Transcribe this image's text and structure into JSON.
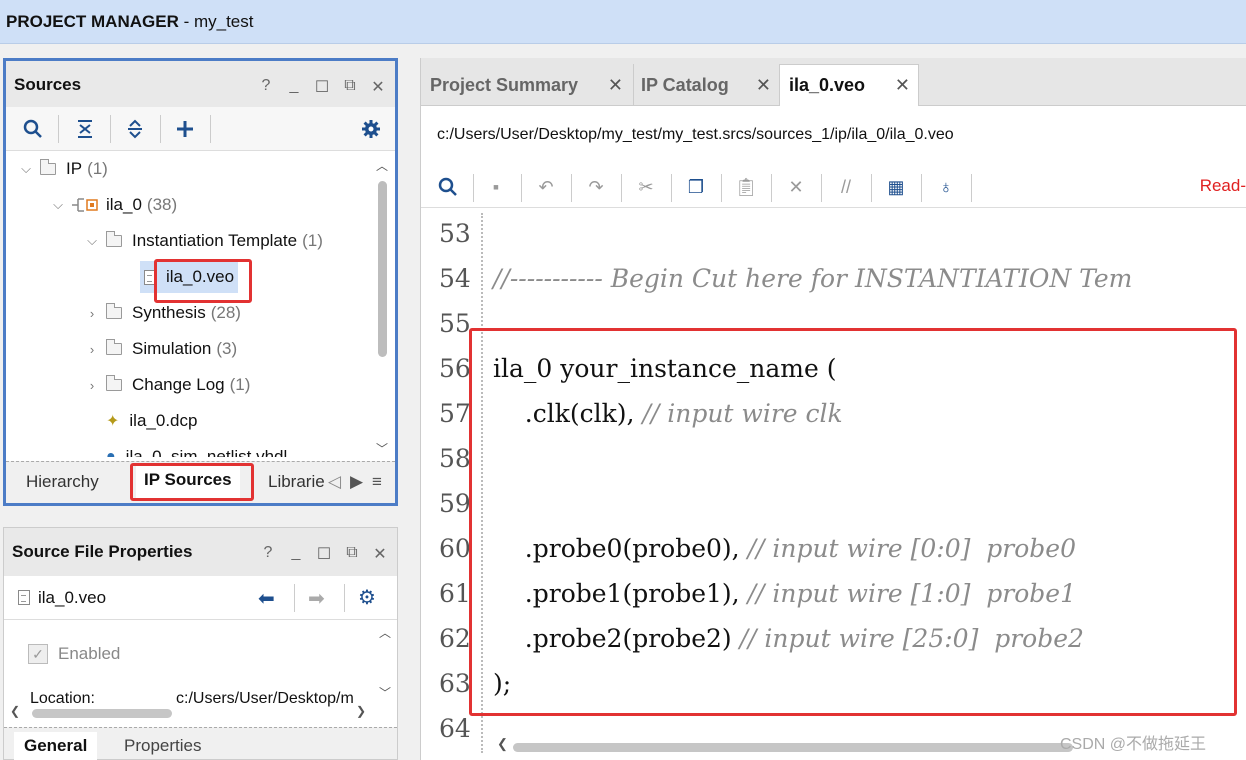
{
  "topbar": {
    "title_bold": "PROJECT MANAGER",
    "title_rest": " - my_test"
  },
  "sources": {
    "title": "Sources",
    "controls": [
      "?",
      "_",
      "☐",
      "⧉",
      "✕"
    ],
    "tree": [
      {
        "label": "IP",
        "count": "(1)"
      },
      {
        "label": "ila_0",
        "count": "(38)"
      },
      {
        "label": "Instantiation Template",
        "count": "(1)"
      },
      {
        "label": "ila_0.veo",
        "count": ""
      },
      {
        "label": "Synthesis",
        "count": "(28)"
      },
      {
        "label": "Simulation",
        "count": "(3)"
      },
      {
        "label": "Change Log",
        "count": "(1)"
      },
      {
        "label": "ila_0.dcp",
        "count": ""
      },
      {
        "label": "ila_0_sim_netlist.vhdl",
        "count": ""
      }
    ],
    "tabs": [
      "Hierarchy",
      "IP Sources",
      "Librarie"
    ]
  },
  "props": {
    "title": "Source File Properties",
    "file": "ila_0.veo",
    "enabled_label": "Enabled",
    "location_label": "Location:",
    "location_value": "c:/Users/User/Desktop/m",
    "tabs": [
      "General",
      "Properties"
    ]
  },
  "editor": {
    "tabs": [
      "Project Summary",
      "IP Catalog",
      "ila_0.veo"
    ],
    "path": "c:/Users/User/Desktop/my_test/my_test.srcs/sources_1/ip/ila_0/ila_0.veo",
    "readonly": "Read-",
    "lines": [
      {
        "n": "53",
        "code": "",
        "comment": ""
      },
      {
        "n": "54",
        "code": "",
        "comment": "//----------- Begin Cut here for INSTANTIATION Tem"
      },
      {
        "n": "55",
        "code": "",
        "comment": ""
      },
      {
        "n": "56",
        "code": "ila_0 your_instance_name (",
        "comment": ""
      },
      {
        "n": "57",
        "code": "    .clk(clk), ",
        "comment": "// input wire clk"
      },
      {
        "n": "58",
        "code": "",
        "comment": ""
      },
      {
        "n": "59",
        "code": "",
        "comment": ""
      },
      {
        "n": "60",
        "code": "    .probe0(probe0), ",
        "comment": "// input wire [0:0]  probe0"
      },
      {
        "n": "61",
        "code": "    .probe1(probe1), ",
        "comment": "// input wire [1:0]  probe1"
      },
      {
        "n": "62",
        "code": "    .probe2(probe2) ",
        "comment": "// input wire [25:0]  probe2"
      },
      {
        "n": "63",
        "code": ");",
        "comment": ""
      },
      {
        "n": "64",
        "code": "",
        "comment": ""
      }
    ]
  },
  "watermark": "CSDN @不做拖延王"
}
